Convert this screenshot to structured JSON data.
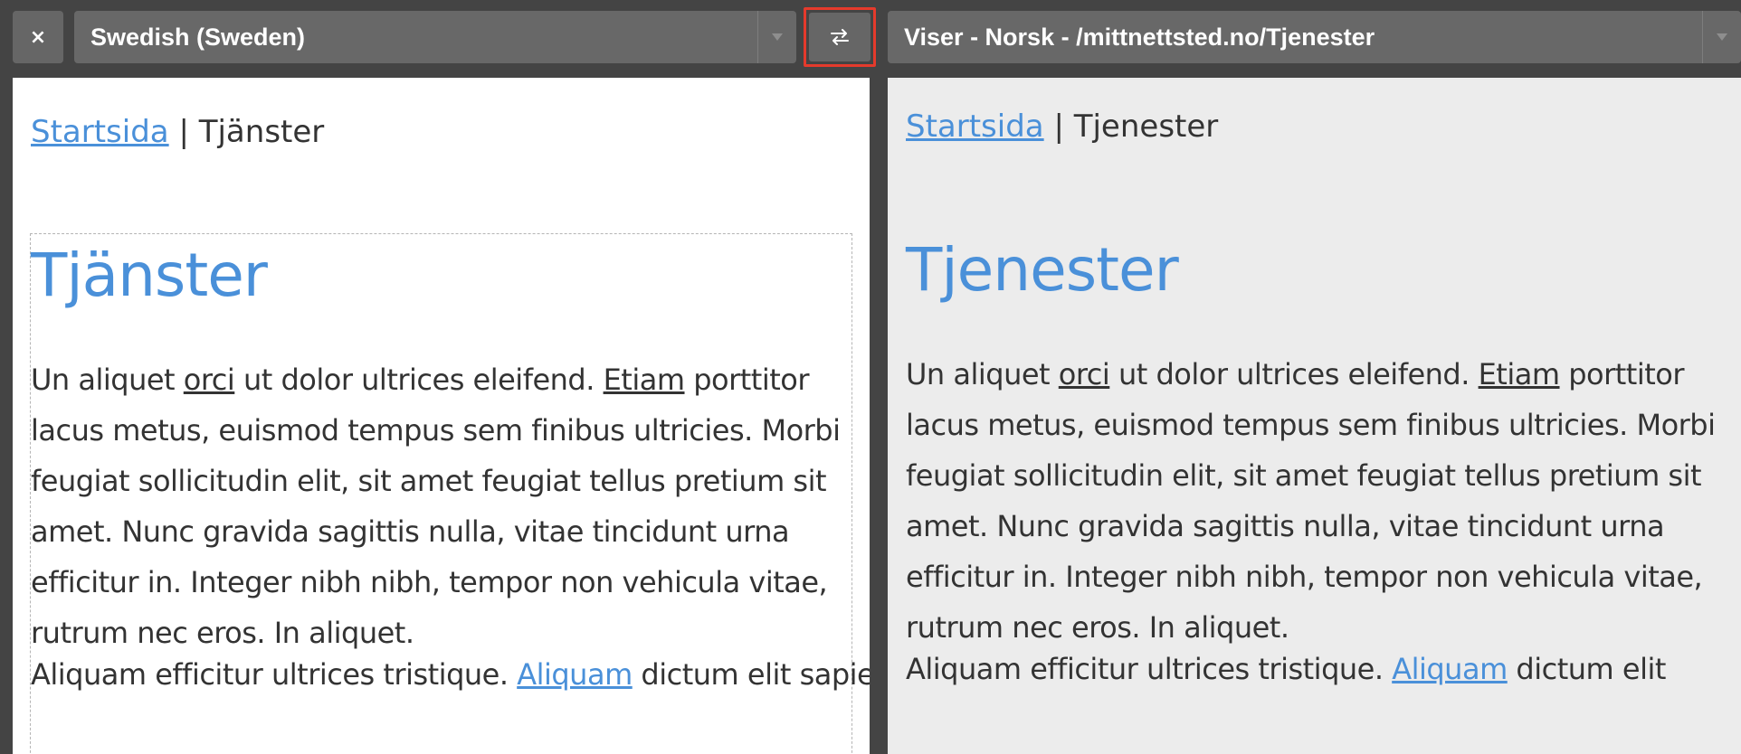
{
  "toolbar": {
    "close_label": "×",
    "language_select": {
      "value": "Swedish (Sweden)"
    },
    "page_select": {
      "value": "Viser - Norsk - /mittnettsted.no/Tjenester"
    }
  },
  "left": {
    "breadcrumb": {
      "home": "Startsida",
      "separator": " | ",
      "current": "Tjänster"
    },
    "heading": "Tjänster",
    "paragraph1": {
      "t1": "Un aliquet ",
      "u1": "orci",
      "t2": " ut dolor ultrices eleifend. ",
      "u2": "Etiam",
      "t3": " porttitor lacus metus, euismod tempus sem finibus ultricies. Morbi feugiat sollicitudin elit, sit amet feugiat tellus pretium sit amet. Nunc gravida sagittis nulla, vitae tincidunt urna efficitur in. Integer nibh nibh, tempor non vehicula vitae, rutrum nec eros. In aliquet."
    },
    "paragraph2": {
      "t1": "Aliquam efficitur ultrices tristique. ",
      "link": "Aliquam",
      "t2": " dictum elit sapien,"
    }
  },
  "right": {
    "breadcrumb": {
      "home": "Startsida",
      "separator": " | ",
      "current": "Tjenester"
    },
    "heading": "Tjenester",
    "paragraph1": {
      "t1": "Un aliquet ",
      "u1": "orci",
      "t2": " ut dolor ultrices eleifend. ",
      "u2": "Etiam",
      "t3": " porttitor lacus metus, euismod tempus sem finibus ultricies. Morbi feugiat sollicitudin elit, sit amet feugiat tellus pretium sit amet. Nunc gravida sagittis nulla, vitae tincidunt urna efficitur in. Integer nibh nibh, tempor non vehicula vitae, rutrum nec eros. In aliquet."
    },
    "paragraph2": {
      "t1": "Aliquam efficitur ultrices tristique. ",
      "link": "Aliquam",
      "t2": " dictum elit"
    }
  },
  "colors": {
    "toolbar_bg": "#444444",
    "control_bg": "#686868",
    "highlight": "#e53a2c",
    "link": "#4a90d9",
    "text": "#333333",
    "right_pane_bg": "#ececec"
  },
  "icons": {
    "close": "close-icon",
    "swap": "swap-arrows-icon",
    "dropdown": "chevron-down-icon"
  }
}
